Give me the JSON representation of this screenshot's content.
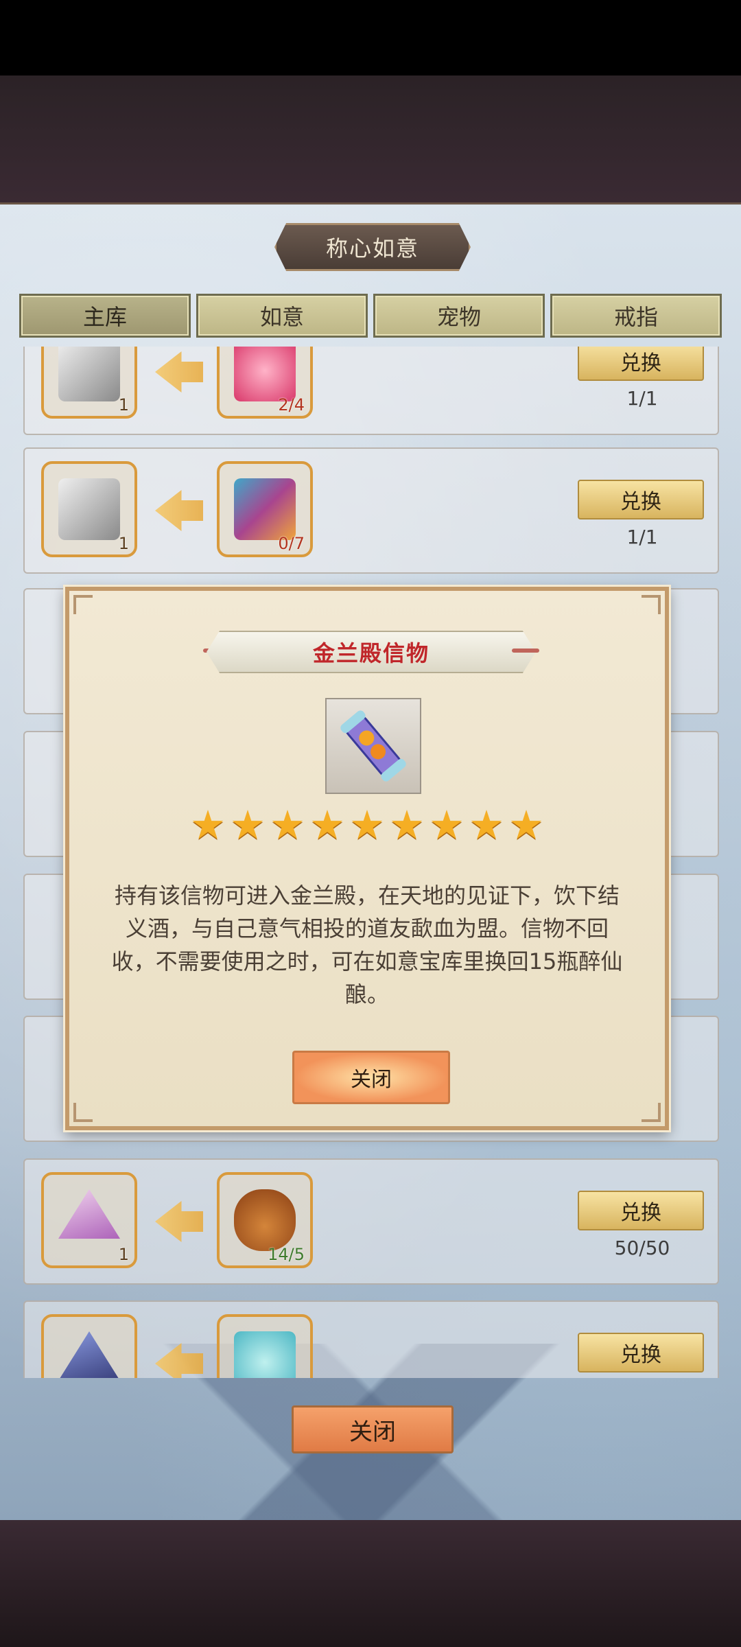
{
  "title": "称心如意",
  "tabs": [
    {
      "label": "主库",
      "active": true
    },
    {
      "label": "如意",
      "active": false
    },
    {
      "label": "宠物",
      "active": false
    },
    {
      "label": "戒指",
      "active": false
    }
  ],
  "rows": [
    {
      "left_count": "1",
      "right_count": "2/4",
      "button": "兑换",
      "progress": "1/1"
    },
    {
      "left_count": "1",
      "right_count": "0/7",
      "button": "兑换",
      "progress": "1/1"
    },
    {
      "left_count": "1",
      "right_count": "14/5",
      "button": "兑换",
      "progress": "50/50"
    },
    {
      "left_count": "",
      "right_count": "",
      "button": "兑换",
      "progress": ""
    }
  ],
  "close_label": "关闭",
  "modal": {
    "title": "金兰殿信物",
    "stars": 9,
    "description": "持有该信物可进入金兰殿，在天地的见证下，饮下结义酒，与自己意气相投的道友歃血为盟。信物不回收，不需要使用之时，可在如意宝库里换回15瓶醉仙酿。",
    "close_label": "关闭"
  }
}
